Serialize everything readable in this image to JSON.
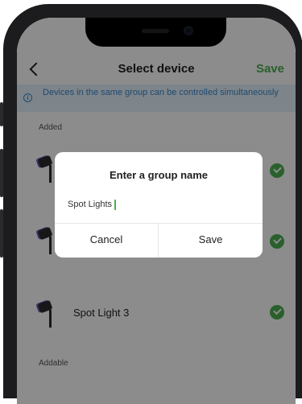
{
  "nav": {
    "title": "Select device",
    "save_label": "Save"
  },
  "info_banner": {
    "icon": "info-icon",
    "text": "Devices in the same group can be controlled simultaneously"
  },
  "sections": {
    "added": "Added",
    "addable": "Addable"
  },
  "devices": [
    {
      "name": "",
      "selected": true,
      "icon": "spotlight-icon"
    },
    {
      "name": "",
      "selected": true,
      "icon": "spotlight-icon"
    },
    {
      "name": "Spot Light 3",
      "selected": true,
      "icon": "spotlight-icon"
    }
  ],
  "dialog": {
    "title": "Enter a group name",
    "input_value": "Spot Lights",
    "cancel_label": "Cancel",
    "save_label": "Save"
  },
  "colors": {
    "accent": "#4caf50",
    "info": "#3a88cc",
    "info_bg": "#e4f1fb"
  }
}
